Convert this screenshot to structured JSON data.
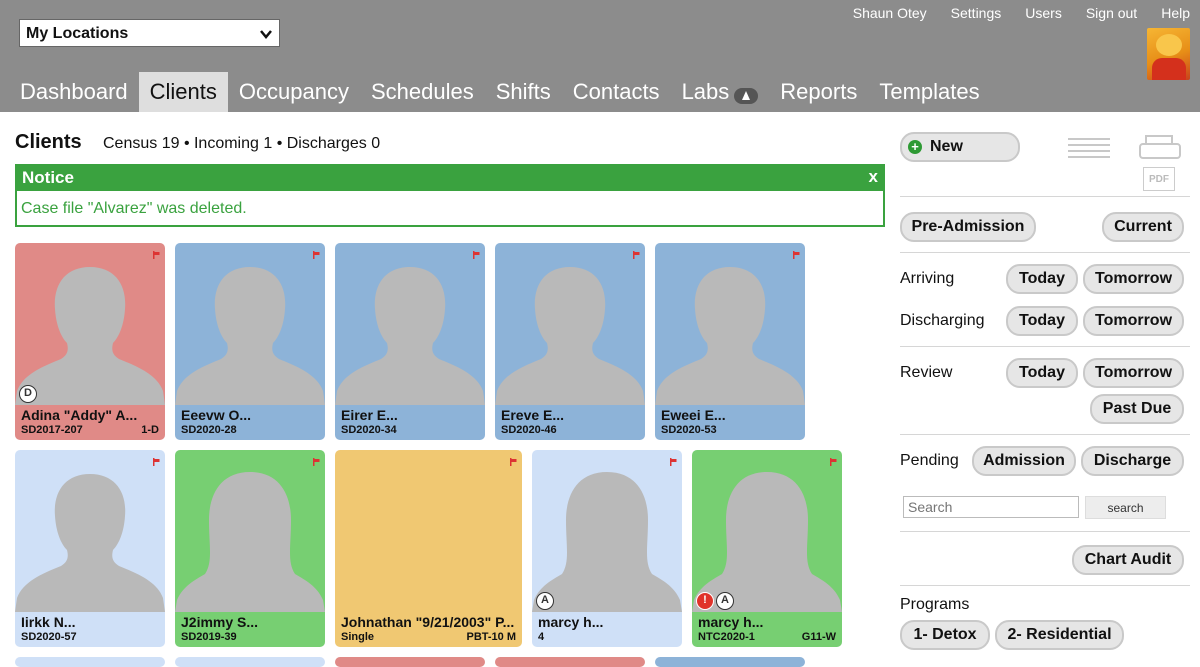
{
  "location_select": {
    "value": "My Locations"
  },
  "user_links": [
    "Shaun Otey",
    "Settings",
    "Users",
    "Sign out",
    "Help"
  ],
  "nav": {
    "tabs": [
      "Dashboard",
      "Clients",
      "Occupancy",
      "Schedules",
      "Shifts",
      "Contacts",
      "Labs",
      "Reports",
      "Templates"
    ],
    "active": "Clients"
  },
  "header": {
    "title": "Clients",
    "census": "Census 19 • Incoming 1 • Discharges 0"
  },
  "notice": {
    "title": "Notice",
    "close": "x",
    "message": "Case file \"Alvarez\" was deleted."
  },
  "colors": {
    "red": "#e08a87",
    "blue": "#8db3d8",
    "light_blue": "#cfe0f7",
    "green": "#77cf72",
    "orange": "#f0c872",
    "notice_green": "#3aa23f"
  },
  "clients": [
    {
      "name": "Adina \"Addy\" A...",
      "id": "SD2017-207",
      "bed": "1-D",
      "color": "red",
      "photo": "male",
      "badges": [
        "D"
      ]
    },
    {
      "name": "Eeevw O...",
      "id": "SD2020-28",
      "bed": "",
      "color": "blue",
      "photo": "male",
      "badges": []
    },
    {
      "name": "Eirer E...",
      "id": "SD2020-34",
      "bed": "",
      "color": "blue",
      "photo": "male",
      "badges": []
    },
    {
      "name": "Ereve E...",
      "id": "SD2020-46",
      "bed": "",
      "color": "blue",
      "photo": "male",
      "badges": []
    },
    {
      "name": "Eweei E...",
      "id": "SD2020-53",
      "bed": "",
      "color": "blue",
      "photo": "male",
      "badges": []
    },
    {
      "name": "Iirkk N...",
      "id": "SD2020-57",
      "bed": "",
      "color": "light_blue",
      "photo": "male",
      "badges": []
    },
    {
      "name": "J2immy S...",
      "id": "SD2019-39",
      "bed": "",
      "color": "green",
      "photo": "female",
      "badges": []
    },
    {
      "name": "Johnathan \"9/21/2003\" P...",
      "id": "Single",
      "bed": "PBT-10 M",
      "color": "orange",
      "photo": "none",
      "badges": []
    },
    {
      "name": "marcy h...",
      "id": "4",
      "bed": "",
      "color": "light_blue",
      "photo": "female",
      "badges": [
        "A"
      ]
    },
    {
      "name": "marcy h...",
      "id": "NTC2020-1",
      "bed": "G11-W",
      "color": "green",
      "photo": "female",
      "badges": [
        "!",
        "A"
      ]
    }
  ],
  "sidebar": {
    "new_label": "New",
    "pre_admission": "Pre-Admission",
    "current": "Current",
    "arriving": "Arriving",
    "discharging": "Discharging",
    "review": "Review",
    "today": "Today",
    "tomorrow": "Tomorrow",
    "past_due": "Past Due",
    "pending": "Pending",
    "admission": "Admission",
    "discharge": "Discharge",
    "search_placeholder": "Search",
    "search_button": "search",
    "chart_audit": "Chart Audit",
    "programs_label": "Programs",
    "programs": [
      "1- Detox",
      "2- Residential"
    ],
    "pdf_label": "PDF"
  }
}
